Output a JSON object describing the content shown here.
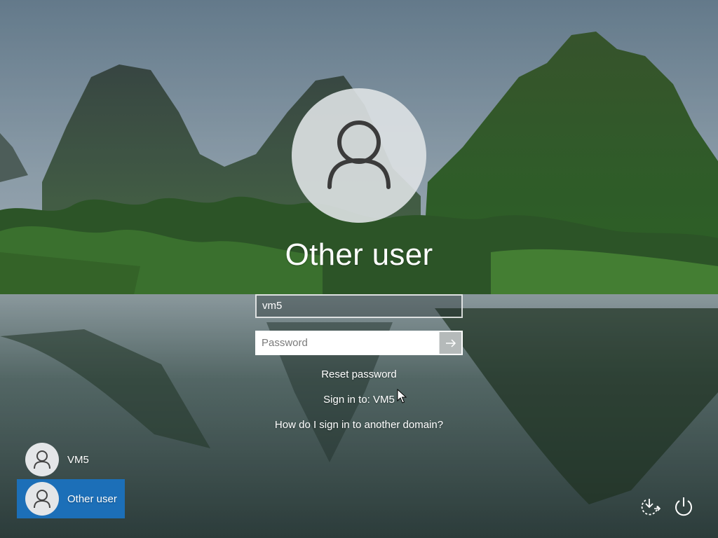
{
  "screen": {
    "type": "windows-sign-in",
    "background": "karst-mountains-river"
  },
  "user_tile": {
    "name": "Other user",
    "icon": "user-icon"
  },
  "form": {
    "username_value": "vm5",
    "password_placeholder": "Password",
    "submit_icon": "arrow-right-icon"
  },
  "links": {
    "reset_password": "Reset password",
    "sign_in_to": "Sign in to: VM5",
    "other_domain": "How do I sign in to another domain?"
  },
  "accounts": [
    {
      "name": "VM5",
      "selected": false
    },
    {
      "name": "Other user",
      "selected": true
    }
  ],
  "corner_buttons": {
    "accessibility_icon": "ease-of-access-icon",
    "power_icon": "power-icon"
  },
  "colors": {
    "selected_account": "#1c6fb8"
  }
}
